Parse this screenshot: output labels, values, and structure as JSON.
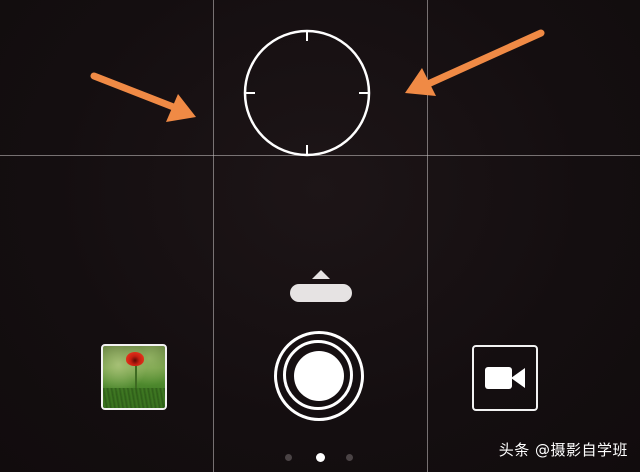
{
  "camera": {
    "grid_enabled": true,
    "focus_ring": "focus-reticle",
    "annotations": {
      "arrow_color": "#f08a45",
      "arrows": [
        "arrow-left-pointing-right",
        "arrow-right-pointing-left"
      ]
    },
    "mode_handle_icon": "chevron-up-icon",
    "gallery_thumbnail": "red-poppy-photo",
    "shutter_icon": "shutter-button-icon",
    "video_mode_icon": "video-camera-icon",
    "pages": {
      "count": 3,
      "active_index": 1
    }
  },
  "watermark": {
    "text": "头条 @摄影自学班"
  }
}
